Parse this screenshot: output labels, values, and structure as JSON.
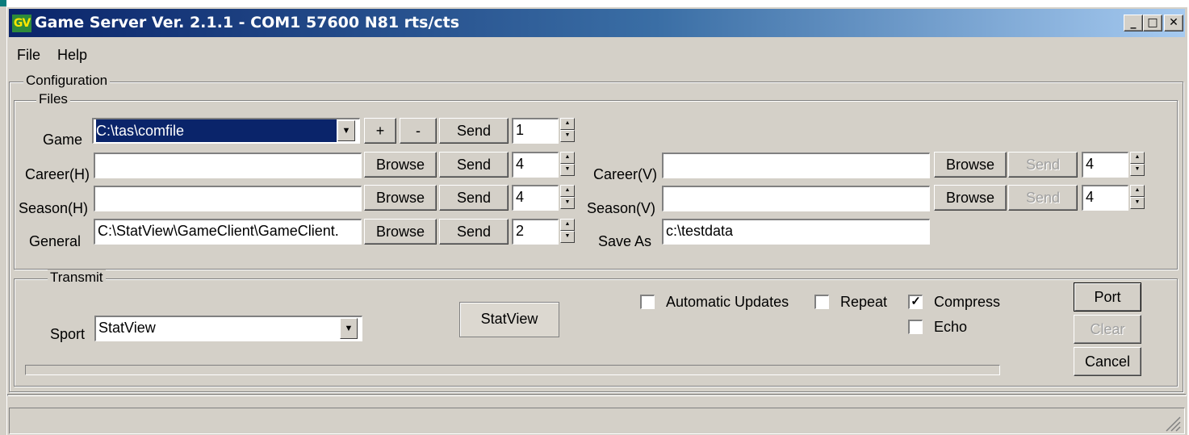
{
  "window": {
    "title": "Game Server Ver. 2.1.1 - COM1 57600 N81 rts/cts",
    "icon_text": "GV",
    "controls": {
      "minimize": "_",
      "maximize": "□",
      "close": "✕"
    }
  },
  "menu": {
    "file": "File",
    "help": "Help"
  },
  "configuration": {
    "label": "Configuration",
    "files": {
      "label": "Files",
      "game": {
        "label": "Game",
        "value": "C:\\tas\\comfile",
        "plus": "+",
        "minus": "-",
        "send": "Send",
        "count": "1"
      },
      "career_h": {
        "label": "Career(H)",
        "value": "",
        "browse": "Browse",
        "send": "Send",
        "count": "4"
      },
      "season_h": {
        "label": "Season(H)",
        "value": "",
        "browse": "Browse",
        "send": "Send",
        "count": "4"
      },
      "general": {
        "label": "General",
        "value": "C:\\StatView\\GameClient\\GameClient.",
        "browse": "Browse",
        "send": "Send",
        "count": "2"
      },
      "career_v": {
        "label": "Career(V)",
        "value": "",
        "browse": "Browse",
        "send": "Send",
        "count": "4"
      },
      "season_v": {
        "label": "Season(V)",
        "value": "",
        "browse": "Browse",
        "send": "Send",
        "count": "4"
      },
      "save_as": {
        "label": "Save As",
        "value": "c:\\testdata"
      }
    }
  },
  "transmit": {
    "label": "Transmit",
    "sport": {
      "label": "Sport",
      "value": "StatView"
    },
    "statview_button": "StatView",
    "automatic_updates": {
      "label": "Automatic Updates",
      "checked": false
    },
    "repeat": {
      "label": "Repeat",
      "checked": false
    },
    "compress": {
      "label": "Compress",
      "checked": true
    },
    "echo": {
      "label": "Echo",
      "checked": false
    },
    "port_button": "Port",
    "clear_button": "Clear",
    "cancel_button": "Cancel"
  }
}
